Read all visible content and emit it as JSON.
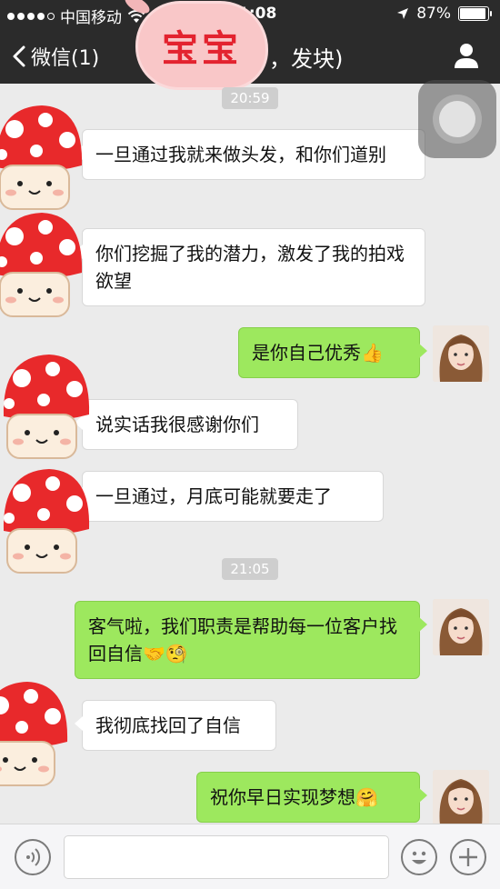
{
  "status_bar": {
    "carrier": "中国移动",
    "time": "1:08",
    "battery": "87%",
    "icons": [
      "signal-dots-icon",
      "wifi-icon",
      "location-arrow-icon",
      "battery-icon"
    ]
  },
  "nav": {
    "back_label": "微信(1)",
    "title": "，发块)",
    "icons": [
      "chevron-left-icon",
      "profile-icon"
    ]
  },
  "stamp_text": "宝宝",
  "messages": [
    {
      "type": "time",
      "text": "20:59"
    },
    {
      "side": "left",
      "text": "一旦通过我就来做头发，和你们道别"
    },
    {
      "side": "left",
      "text": "你们挖掘了我的潜力，激发了我的拍戏欲望"
    },
    {
      "side": "right",
      "text": "是你自己优秀",
      "emoji": "👍"
    },
    {
      "side": "left",
      "text": "说实话我很感谢你们"
    },
    {
      "side": "left",
      "text": "一旦通过，月底可能就要走了"
    },
    {
      "type": "time",
      "text": "21:05"
    },
    {
      "side": "right",
      "text": "客气啦，我们职责是帮助每一位客户找回自信",
      "emoji": "🤝🧐"
    },
    {
      "side": "left",
      "text": "我彻底找回了自信"
    },
    {
      "side": "right",
      "text": "祝你早日实现梦想",
      "emoji": "🤗"
    }
  ],
  "input_bar": {
    "icons": [
      "voice-icon",
      "emoji-face-icon",
      "plus-icon"
    ]
  },
  "colors": {
    "nav_bg": "#2b2b2b",
    "chat_bg": "#ebebeb",
    "out_bubble": "#9de85e",
    "in_bubble": "#ffffff",
    "stamp_text": "#e3232f"
  }
}
